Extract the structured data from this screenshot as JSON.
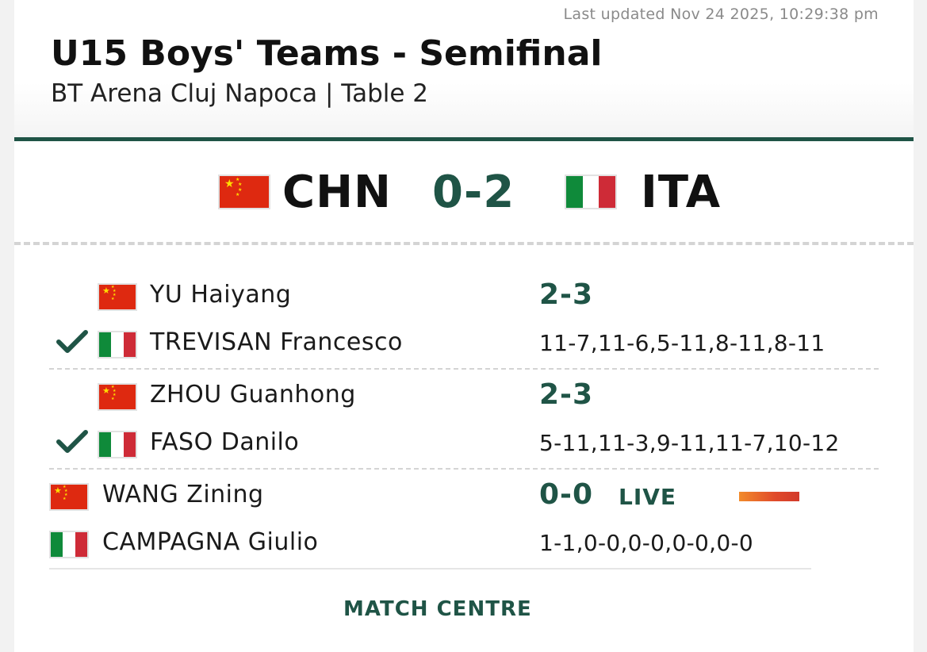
{
  "header": {
    "last_updated": "Last updated Nov 24 2025, 10:29:38 pm",
    "title": "U15 Boys' Teams - Semifinal",
    "subtitle": "BT Arena Cluj Napoca | Table 2"
  },
  "team_match": {
    "home_code": "CHN",
    "away_code": "ITA",
    "score": "0-2"
  },
  "matches": [
    {
      "home_player": "YU Haiyang",
      "away_player": "TREVISAN Francesco",
      "score": "2-3",
      "games": "11-7,11-6,5-11,8-11,8-11",
      "winner": "away"
    },
    {
      "home_player": "ZHOU Guanhong",
      "away_player": "FASO Danilo",
      "score": "2-3",
      "games": "5-11,11-3,9-11,11-7,10-12",
      "winner": "away"
    },
    {
      "home_player": "WANG Zining",
      "away_player": "CAMPAGNA Giulio",
      "score": "0-0",
      "games": "1-1,0-0,0-0,0-0,0-0",
      "status": "LIVE"
    }
  ],
  "footer": {
    "match_centre_label": "MATCH CENTRE"
  },
  "colors": {
    "accent": "#1f5446",
    "live_bar": "#e04a2a",
    "china_red": "#de2910",
    "italy_green": "#0f8a3a",
    "italy_red": "#ce2b37"
  }
}
